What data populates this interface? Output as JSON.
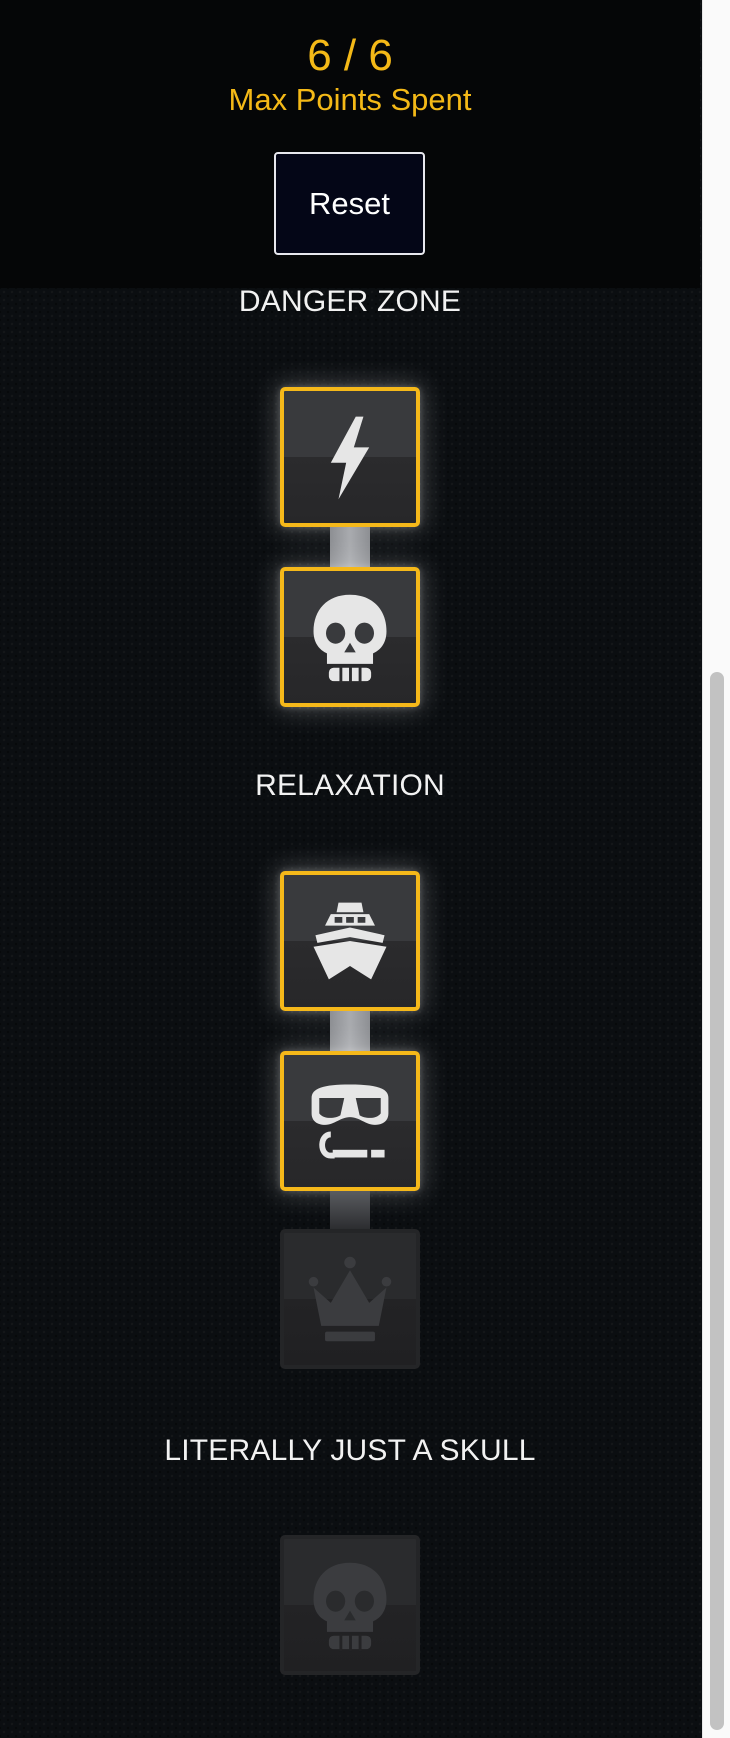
{
  "header": {
    "points": "6 / 6",
    "points_label": "Max Points Spent",
    "reset_label": "Reset"
  },
  "sections": [
    {
      "title": "DANGER ZONE",
      "nodes": [
        {
          "icon": "lightning-bolt-icon",
          "state": "active"
        },
        {
          "icon": "skull-icon",
          "state": "active"
        }
      ]
    },
    {
      "title": "RELAXATION",
      "nodes": [
        {
          "icon": "boat-icon",
          "state": "active"
        },
        {
          "icon": "snorkel-mask-icon",
          "state": "active"
        },
        {
          "icon": "crown-icon",
          "state": "locked"
        }
      ]
    },
    {
      "title": "LITERALLY JUST A SKULL",
      "nodes": [
        {
          "icon": "skull-icon",
          "state": "locked"
        }
      ]
    }
  ],
  "colors": {
    "accent": "#f5b81a",
    "background": "#0b0e11",
    "header_background": "#050607",
    "button_background": "#040617"
  }
}
